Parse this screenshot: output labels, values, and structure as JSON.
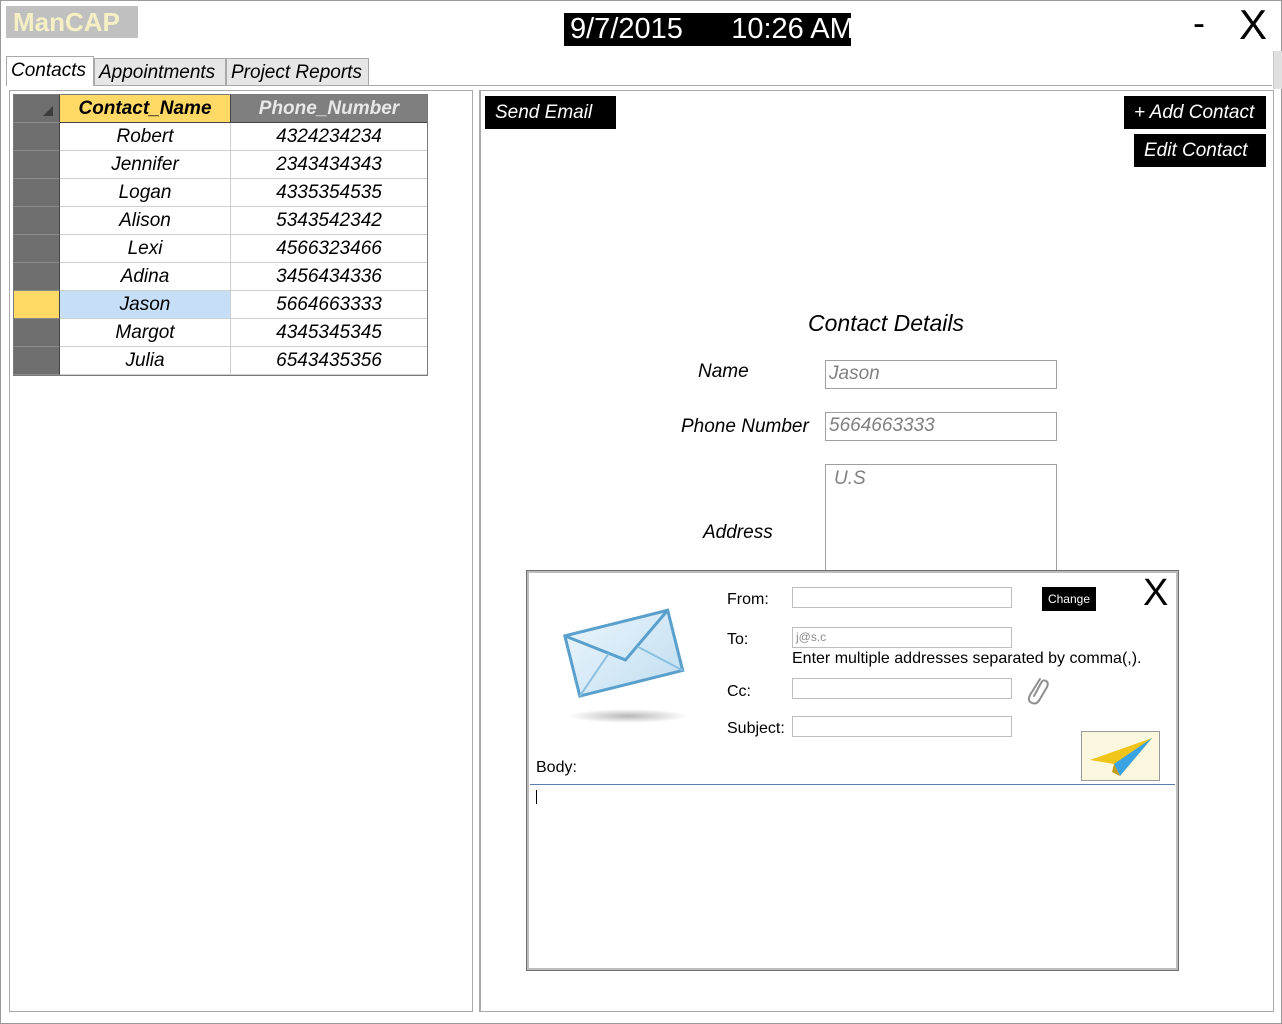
{
  "app": {
    "title": "ManCAP",
    "date": "9/7/2015",
    "time": "10:26 AM",
    "minimize": "-",
    "close": "X"
  },
  "tabs": [
    {
      "label": "Contacts"
    },
    {
      "label": "Appointments"
    },
    {
      "label": "Project Reports"
    }
  ],
  "grid": {
    "columns": [
      "Contact_Name",
      "Phone_Number"
    ],
    "rows": [
      {
        "name": "Robert",
        "phone": "4324234234"
      },
      {
        "name": "Jennifer",
        "phone": "2343434343"
      },
      {
        "name": "Logan",
        "phone": "4335354535"
      },
      {
        "name": "Alison",
        "phone": "5343542342"
      },
      {
        "name": "Lexi",
        "phone": "4566323466"
      },
      {
        "name": "Adina",
        "phone": "3456434336"
      },
      {
        "name": "Jason",
        "phone": "5664663333"
      },
      {
        "name": "Margot",
        "phone": "4345345345"
      },
      {
        "name": "Julia",
        "phone": "6543435356"
      }
    ],
    "selected_index": 6
  },
  "buttons": {
    "send_email": "Send Email",
    "add_contact": "+ Add Contact",
    "edit_contact": "Edit Contact"
  },
  "details": {
    "title": "Contact Details",
    "name_label": "Name",
    "name_value": "Jason",
    "phone_label": "Phone Number",
    "phone_value": "5664663333",
    "address_label": "Address",
    "address_value": "U.S"
  },
  "email_dialog": {
    "close": "X",
    "from_label": "From:",
    "from_value": "",
    "change_label": "Change",
    "to_label": "To:",
    "to_value": "j@s.c",
    "hint": "Enter multiple addresses separated by comma(,).",
    "cc_label": "Cc:",
    "cc_value": "",
    "subject_label": "Subject:",
    "subject_value": "",
    "body_label": "Body:",
    "body_value": ""
  },
  "colors": {
    "header_accent": "#ffd966",
    "selected_row": "#c6dff7",
    "logo_bg": "#c0c0c0"
  },
  "icons": [
    "envelope-icon",
    "paperclip-icon",
    "paper-plane-icon"
  ]
}
